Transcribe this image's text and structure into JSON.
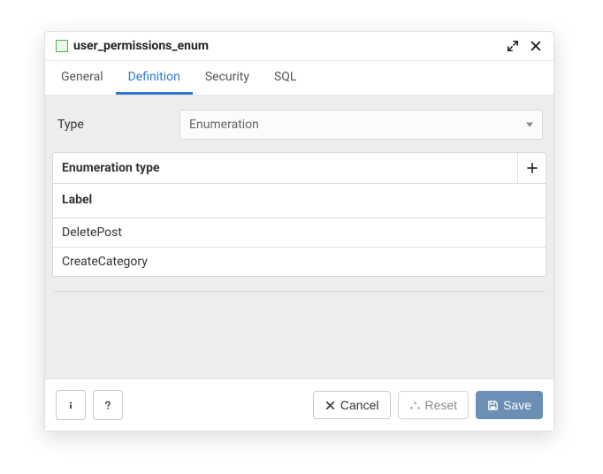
{
  "header": {
    "title": "user_permissions_enum"
  },
  "tabs": [
    {
      "label": "General",
      "active": false
    },
    {
      "label": "Definition",
      "active": true
    },
    {
      "label": "Security",
      "active": false
    },
    {
      "label": "SQL",
      "active": false
    }
  ],
  "form": {
    "type_label": "Type",
    "type_value": "Enumeration"
  },
  "enumeration": {
    "section_title": "Enumeration type",
    "column_header": "Label",
    "rows": [
      {
        "label": "DeletePost"
      },
      {
        "label": "CreateCategory"
      }
    ]
  },
  "footer": {
    "cancel": "Cancel",
    "reset": "Reset",
    "save": "Save"
  }
}
